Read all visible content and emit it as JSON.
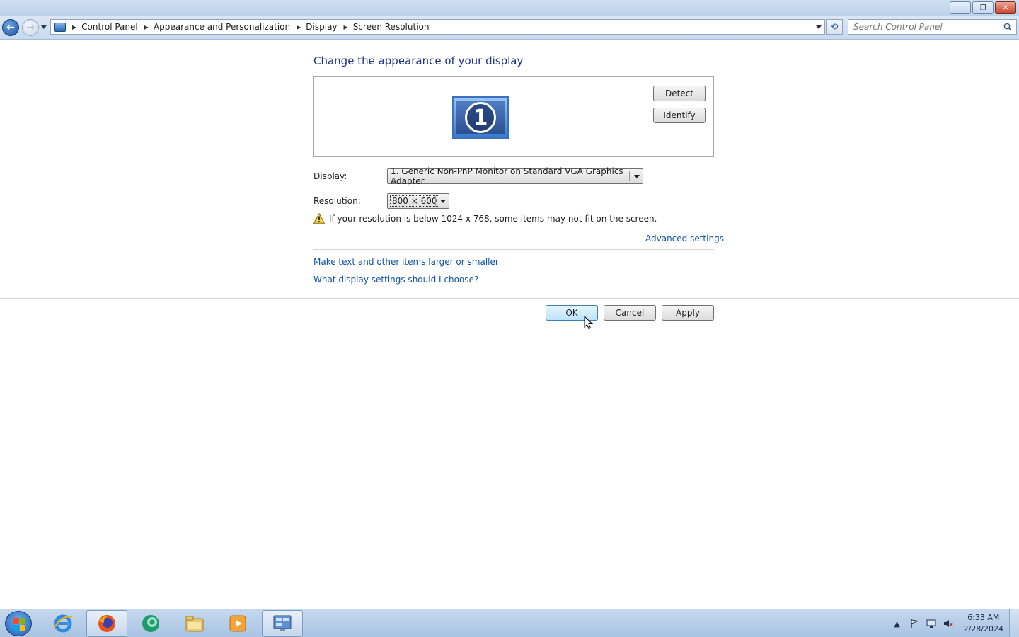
{
  "window": {
    "controls": {
      "minimize": "—",
      "restore": "❐",
      "close": "✕"
    }
  },
  "navigation": {
    "back_glyph": "←",
    "forward_glyph": "→",
    "breadcrumb": [
      "Control Panel",
      "Appearance and Personalization",
      "Display",
      "Screen Resolution"
    ],
    "refresh_glyph": "⟲",
    "search_placeholder": "Search Control Panel"
  },
  "content": {
    "heading": "Change the appearance of your display",
    "monitor_number": "1",
    "detect_label": "Detect",
    "identify_label": "Identify",
    "display_label": "Display:",
    "display_value": "1. Generic Non-PnP Monitor on Standard VGA Graphics Adapter",
    "resolution_label": "Resolution:",
    "resolution_value": "800 × 600",
    "warning_text": "If your resolution is below 1024 x 768, some items may not fit on the screen.",
    "advanced_settings_link": "Advanced settings",
    "links": [
      "Make text and other items larger or smaller",
      "What display settings should I choose?"
    ],
    "ok_label": "OK",
    "cancel_label": "Cancel",
    "apply_label": "Apply"
  },
  "taskbar": {
    "apps": [
      "internet-explorer",
      "firefox",
      "app-green",
      "file-explorer",
      "media-player",
      "control-panel"
    ],
    "tray_arrow": "▲",
    "time": "6:33 AM",
    "date": "2/28/2024"
  },
  "colors": {
    "heading": "#1e3287",
    "link": "#0e55a6",
    "accent": "#3c7fb1"
  }
}
